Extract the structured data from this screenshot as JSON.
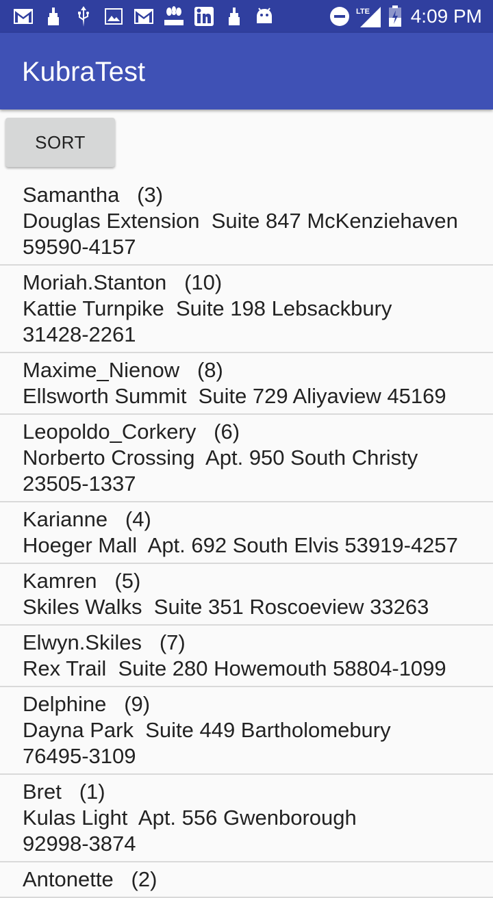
{
  "status_bar": {
    "time": "4:09 PM",
    "network": "LTE",
    "icons_left": [
      "gmail-icon",
      "cleaner-icon",
      "usb-icon",
      "image-icon",
      "gmail-icon",
      "nbc-news-icon",
      "linkedin-icon",
      "cleaner-icon",
      "android-icon"
    ],
    "icons_right": [
      "do-not-disturb-icon",
      "signal-icon",
      "battery-icon"
    ]
  },
  "app": {
    "title": "KubraTest"
  },
  "sort_button": {
    "label": "SORT"
  },
  "list": {
    "items": [
      {
        "name": "Samantha   (3)",
        "address": "Douglas Extension  Suite 847 McKenziehaven",
        "zip": "59590-4157"
      },
      {
        "name": "Moriah.Stanton   (10)",
        "address": "Kattie Turnpike  Suite 198 Lebsackbury",
        "zip": "31428-2261"
      },
      {
        "name": "Maxime_Nienow   (8)",
        "address": "Ellsworth Summit  Suite 729 Aliyaview 45169",
        "zip": ""
      },
      {
        "name": "Leopoldo_Corkery   (6)",
        "address": "Norberto Crossing  Apt. 950 South Christy",
        "zip": "23505-1337"
      },
      {
        "name": "Karianne   (4)",
        "address": "Hoeger Mall  Apt. 692 South Elvis 53919-4257",
        "zip": ""
      },
      {
        "name": "Kamren   (5)",
        "address": "Skiles Walks  Suite 351 Roscoeview 33263",
        "zip": ""
      },
      {
        "name": "Elwyn.Skiles   (7)",
        "address": "Rex Trail  Suite 280 Howemouth 58804-1099",
        "zip": ""
      },
      {
        "name": "Delphine   (9)",
        "address": "Dayna Park  Suite 449 Bartholomebury",
        "zip": "76495-3109"
      },
      {
        "name": "Bret   (1)",
        "address": "Kulas Light  Apt. 556 Gwenborough",
        "zip": "92998-3874"
      },
      {
        "name": "Antonette   (2)",
        "address": "",
        "zip": ""
      }
    ]
  }
}
